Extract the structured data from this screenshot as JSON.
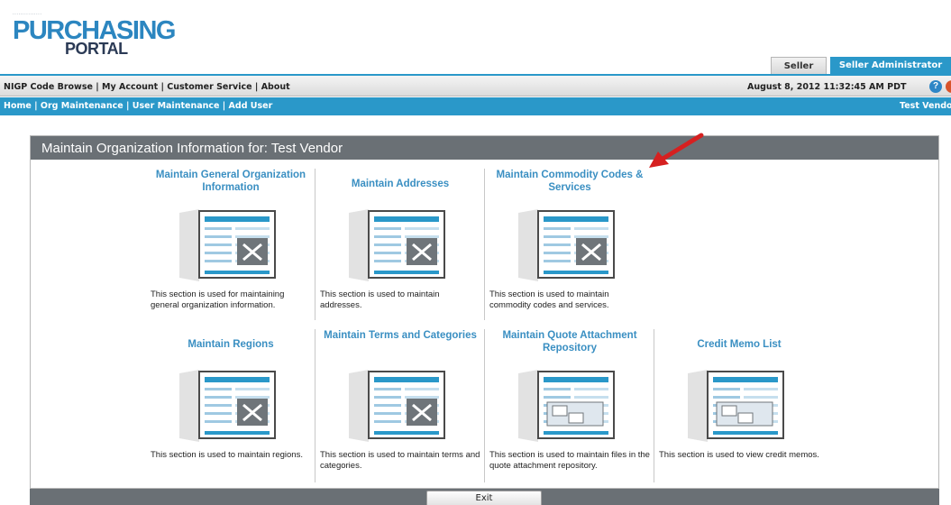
{
  "logo": {
    "tagline": "...............",
    "line1": "PURCHASING",
    "line2": "PORTAL"
  },
  "role_tabs": {
    "seller": "Seller",
    "admin": "Seller Administrator"
  },
  "top_links": [
    "NIGP Code Browse",
    "My Account",
    "Customer Service",
    "About"
  ],
  "datetime": "August 8, 2012 11:32:45 AM PDT",
  "nav": {
    "items": [
      "Home",
      "Org Maintenance",
      "User Maintenance",
      "Add User"
    ],
    "vendor": "Test Vendor"
  },
  "panel": {
    "title": "Maintain Organization Information for: Test Vendor",
    "cards": [
      {
        "title": "Maintain General Organization Information",
        "desc": "This section is used for maintaining general organization information.",
        "icon": "form-tools-icon"
      },
      {
        "title": "Maintain Addresses",
        "desc": "This section is used to maintain addresses.",
        "icon": "form-tools-icon"
      },
      {
        "title": "Maintain Commodity Codes & Services",
        "desc": "This section is used to maintain commodity codes and services.",
        "icon": "form-tools-icon"
      },
      {
        "title": "Maintain Regions",
        "desc": "This section is used to maintain regions.",
        "icon": "form-tools-icon"
      },
      {
        "title": "Maintain Terms and Categories",
        "desc": "This section is used to maintain terms and categories.",
        "icon": "form-tools-icon"
      },
      {
        "title": "Maintain Quote Attachment Repository",
        "desc": "This section is used to maintain files in the quote attachment repository.",
        "icon": "form-documents-icon"
      },
      {
        "title": "Credit Memo List",
        "desc": "This section is used to view credit memos.",
        "icon": "form-documents-icon"
      }
    ]
  },
  "exit_label": "Exit",
  "colors": {
    "accent": "#2a98c9",
    "panel_header": "#6a7075",
    "link_blue": "#3a8fc2",
    "arrow": "#d62020"
  }
}
